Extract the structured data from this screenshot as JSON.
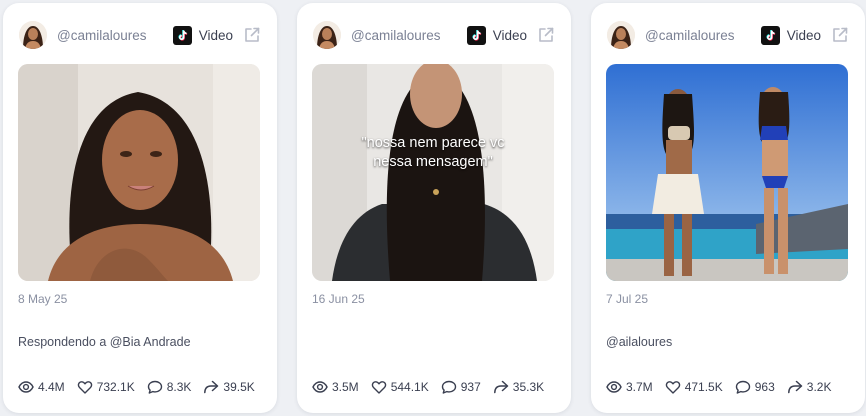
{
  "colors": {
    "page_background": "#eef0f4",
    "card_background": "#ffffff",
    "muted_text": "#7b8194",
    "icon": "#3a3f50"
  },
  "posts": [
    {
      "username": "@camilaloures",
      "platform_icon": "tiktok-icon",
      "type": "Video",
      "date": "8 May 25",
      "caption": "Respondendo a @Bia Andrade",
      "overlay_text": "",
      "stats": {
        "views": "4.4M",
        "likes": "732.1K",
        "comments": "8.3K",
        "shares": "39.5K"
      }
    },
    {
      "username": "@camilaloures",
      "platform_icon": "tiktok-icon",
      "type": "Video",
      "date": "16 Jun 25",
      "caption": "",
      "overlay_text": "\"nossa nem parece vc nessa mensagem\"",
      "stats": {
        "views": "3.5M",
        "likes": "544.1K",
        "comments": "937",
        "shares": "35.3K"
      }
    },
    {
      "username": "@camilaloures",
      "platform_icon": "tiktok-icon",
      "type": "Video",
      "date": "7 Jul 25",
      "caption": "@ailaloures",
      "overlay_text": "",
      "stats": {
        "views": "3.7M",
        "likes": "471.5K",
        "comments": "963",
        "shares": "3.2K"
      }
    }
  ]
}
